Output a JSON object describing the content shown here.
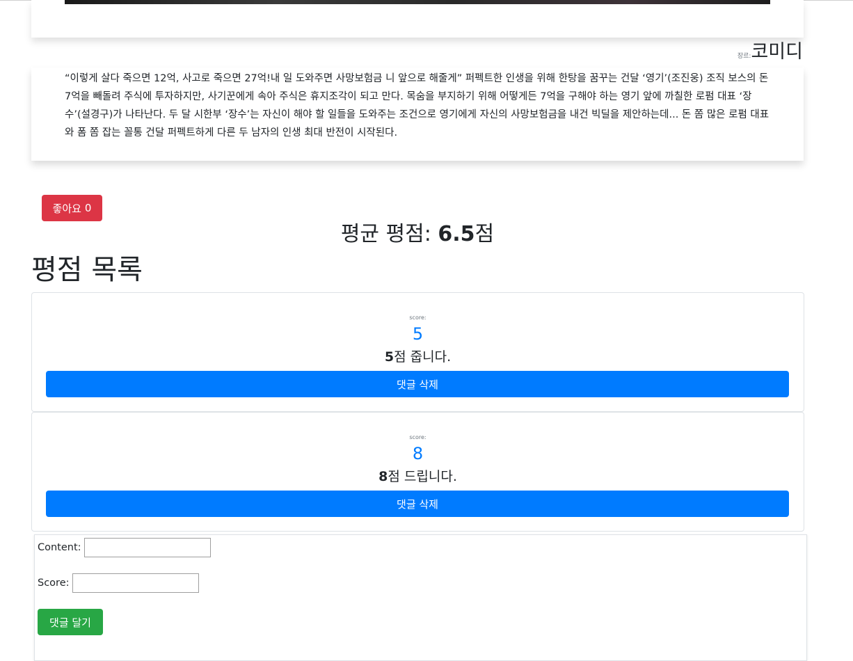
{
  "movie": {
    "genre_label": "장르:",
    "genre_value": "코미디",
    "synopsis": "“이렇게 살다 죽으면 12억, 사고로 죽으면 27억!내 일 도와주면 사망보험금 니 앞으로 해줄게” 퍼펙트한 인생을 위해 한탕을 꿈꾸는 건달 ‘영기’(조진웅) 조직 보스의 돈 7억을 빼돌려 주식에 투자하지만, 사기꾼에게 속아 주식은 휴지조각이 되고 만다. 목숨을 부지하기 위해 어떻게든 7억을 구해야 하는 영기 앞에 까칠한 로펌 대표 ‘장수’(설경구)가 나타난다.  두 달 시한부 ‘장수’는 자신이 해야 할 일들을 도와주는 조건으로 영기에게 자신의 사망보험금을 내건 빅딜을 제안하는데...  돈 쫌 많은 로펌 대표와 폼 쫌 잡는 꼴통 건달 퍼펙트하게 다른 두 남자의 인생 최대 반전이 시작된다."
  },
  "like": {
    "label": "좋아요",
    "count": "0"
  },
  "rating": {
    "prefix": "평균 평점: ",
    "value": "6.5",
    "suffix": "점"
  },
  "reviews": {
    "title": "평점 목록",
    "score_label": "score:",
    "delete_label": "댓글 삭제",
    "items": [
      {
        "score": "5",
        "content_score": "5",
        "content_text": "점 줍니다."
      },
      {
        "score": "8",
        "content_score": "8",
        "content_text": "점 드립니다."
      }
    ]
  },
  "form": {
    "content_label": "Content:",
    "content_value": "",
    "score_label": "Score:",
    "score_value": "",
    "submit_label": "댓글 달기"
  }
}
